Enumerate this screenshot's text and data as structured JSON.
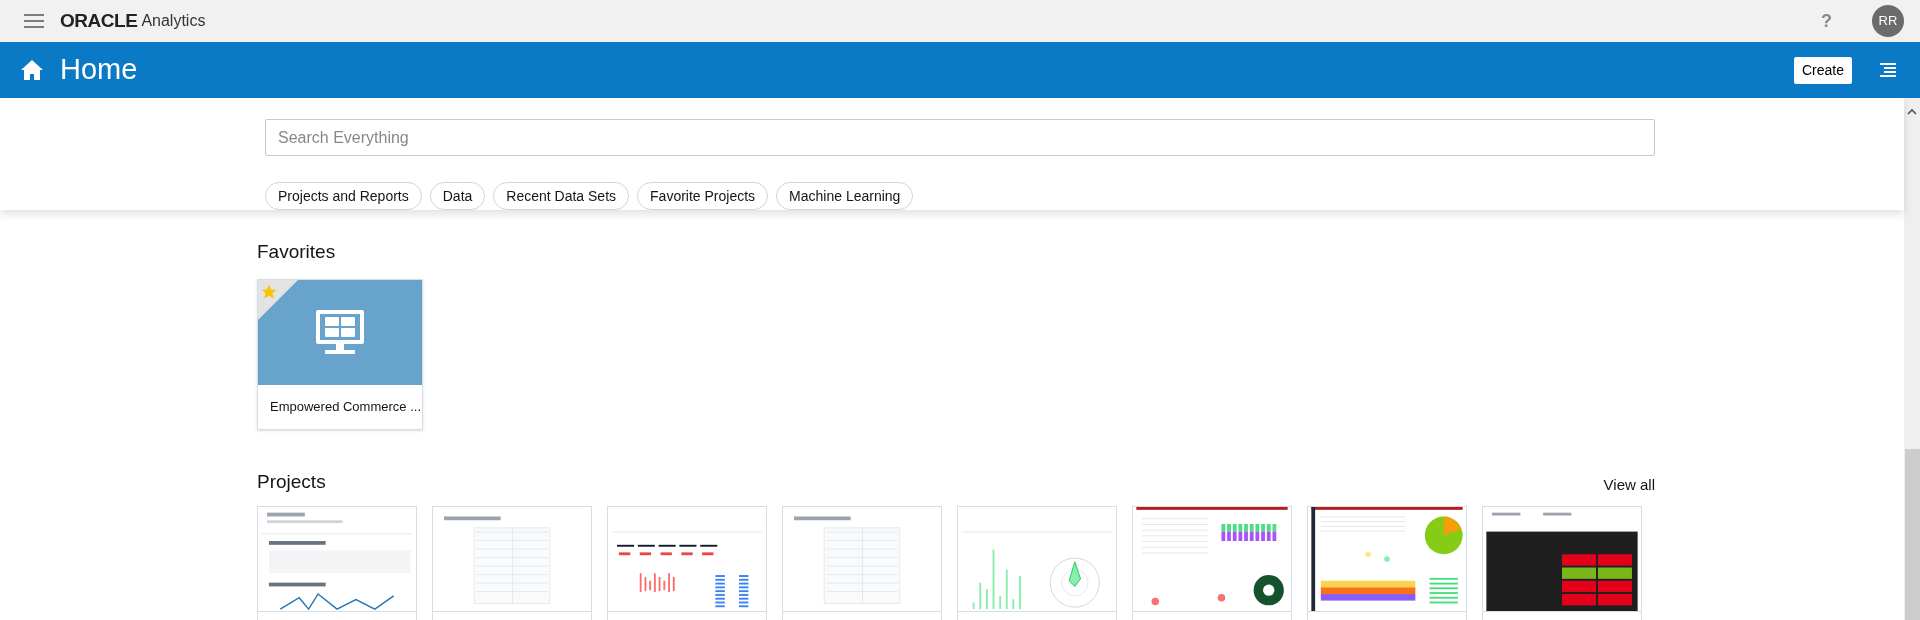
{
  "topbar": {
    "brand": "ORACLE",
    "product": "Analytics",
    "help": "?",
    "avatar": "RR"
  },
  "header": {
    "title": "Home",
    "create": "Create"
  },
  "search": {
    "placeholder": "Search Everything"
  },
  "filters": [
    {
      "label": "Projects and Reports"
    },
    {
      "label": "Data"
    },
    {
      "label": "Recent Data Sets"
    },
    {
      "label": "Favorite Projects"
    },
    {
      "label": "Machine Learning"
    }
  ],
  "favorites": {
    "title": "Favorites",
    "items": [
      {
        "name": "Empowered Commerce ...",
        "favorite": true
      }
    ]
  },
  "projects": {
    "title": "Projects",
    "view_all": "View all",
    "items": [
      {
        "kind": "report"
      },
      {
        "kind": "table"
      },
      {
        "kind": "performance"
      },
      {
        "kind": "table"
      },
      {
        "kind": "radar"
      },
      {
        "kind": "bars"
      },
      {
        "kind": "dark-bands"
      },
      {
        "kind": "heat-table"
      }
    ]
  }
}
